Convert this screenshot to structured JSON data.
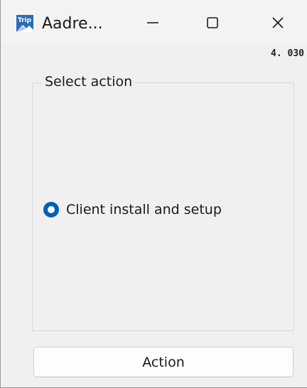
{
  "window": {
    "title": "Aadre...",
    "app_icon": "trip-app-icon",
    "version": "4. 030"
  },
  "title_buttons": {
    "minimize_icon": "minimize-icon",
    "maximize_icon": "maximize-icon",
    "close_icon": "close-icon"
  },
  "group": {
    "legend": "Select action",
    "options": [
      {
        "label": "Client install and setup",
        "selected": true
      }
    ]
  },
  "action_button": {
    "label": "Action"
  },
  "colors": {
    "accent": "#005fb8",
    "window_bg": "#f0f0f0",
    "titlebar_bg": "#f3f3f3"
  }
}
